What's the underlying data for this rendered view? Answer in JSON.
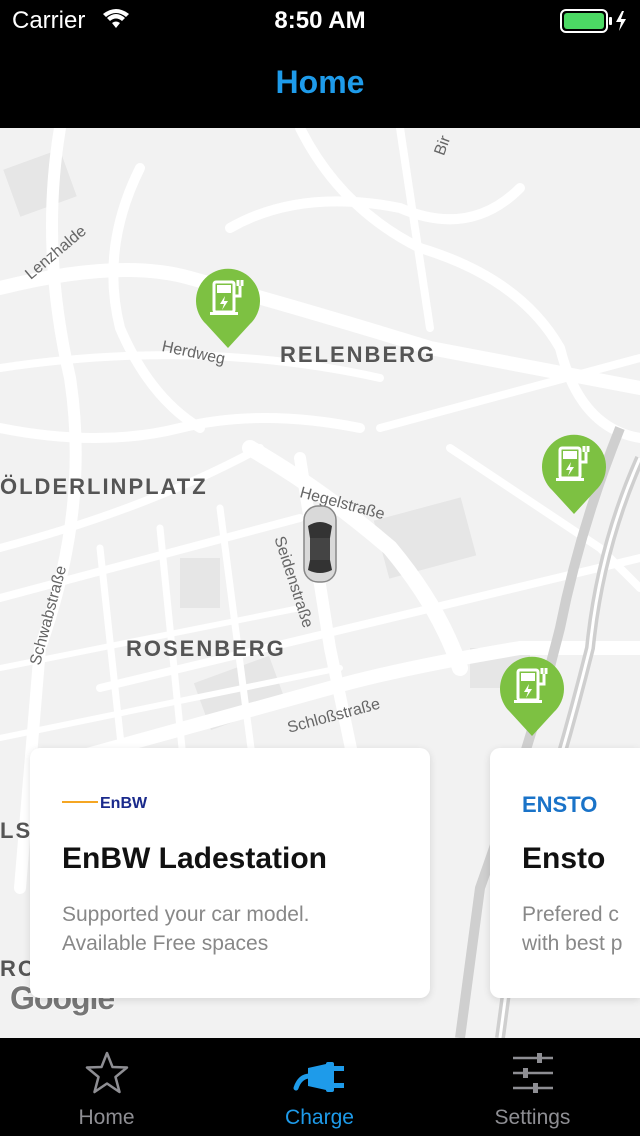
{
  "status_bar": {
    "carrier": "Carrier",
    "time": "8:50 AM"
  },
  "nav": {
    "title": "Home"
  },
  "map": {
    "street_labels": [
      "Lenzhalde",
      "Herdweg",
      "Hegelstraße",
      "Seidenstraße",
      "Schwabstraße",
      "Schloßstraße",
      "Bir"
    ],
    "district_labels": [
      "RELENBERG",
      "ÖLDERLINPLATZ",
      "ROSENBERG",
      "LS",
      "RO"
    ],
    "attribution": "Google"
  },
  "stations": [
    {
      "brand": "EnBW",
      "name": "EnBW Ladestation",
      "desc_line1": "Supported your car model.",
      "desc_line2": "Available Free spaces"
    },
    {
      "brand": "ENSTO",
      "name": "Ensto",
      "desc_line1": "Prefered c",
      "desc_line2": "with best p"
    }
  ],
  "tabs": [
    {
      "label": "Home",
      "icon": "star-icon"
    },
    {
      "label": "Charge",
      "icon": "plug-icon"
    },
    {
      "label": "Settings",
      "icon": "sliders-icon"
    }
  ],
  "selected_tab": "Charge",
  "colors": {
    "accent": "#1e9bea",
    "pin": "#7dc142",
    "battery": "#4cd964"
  }
}
